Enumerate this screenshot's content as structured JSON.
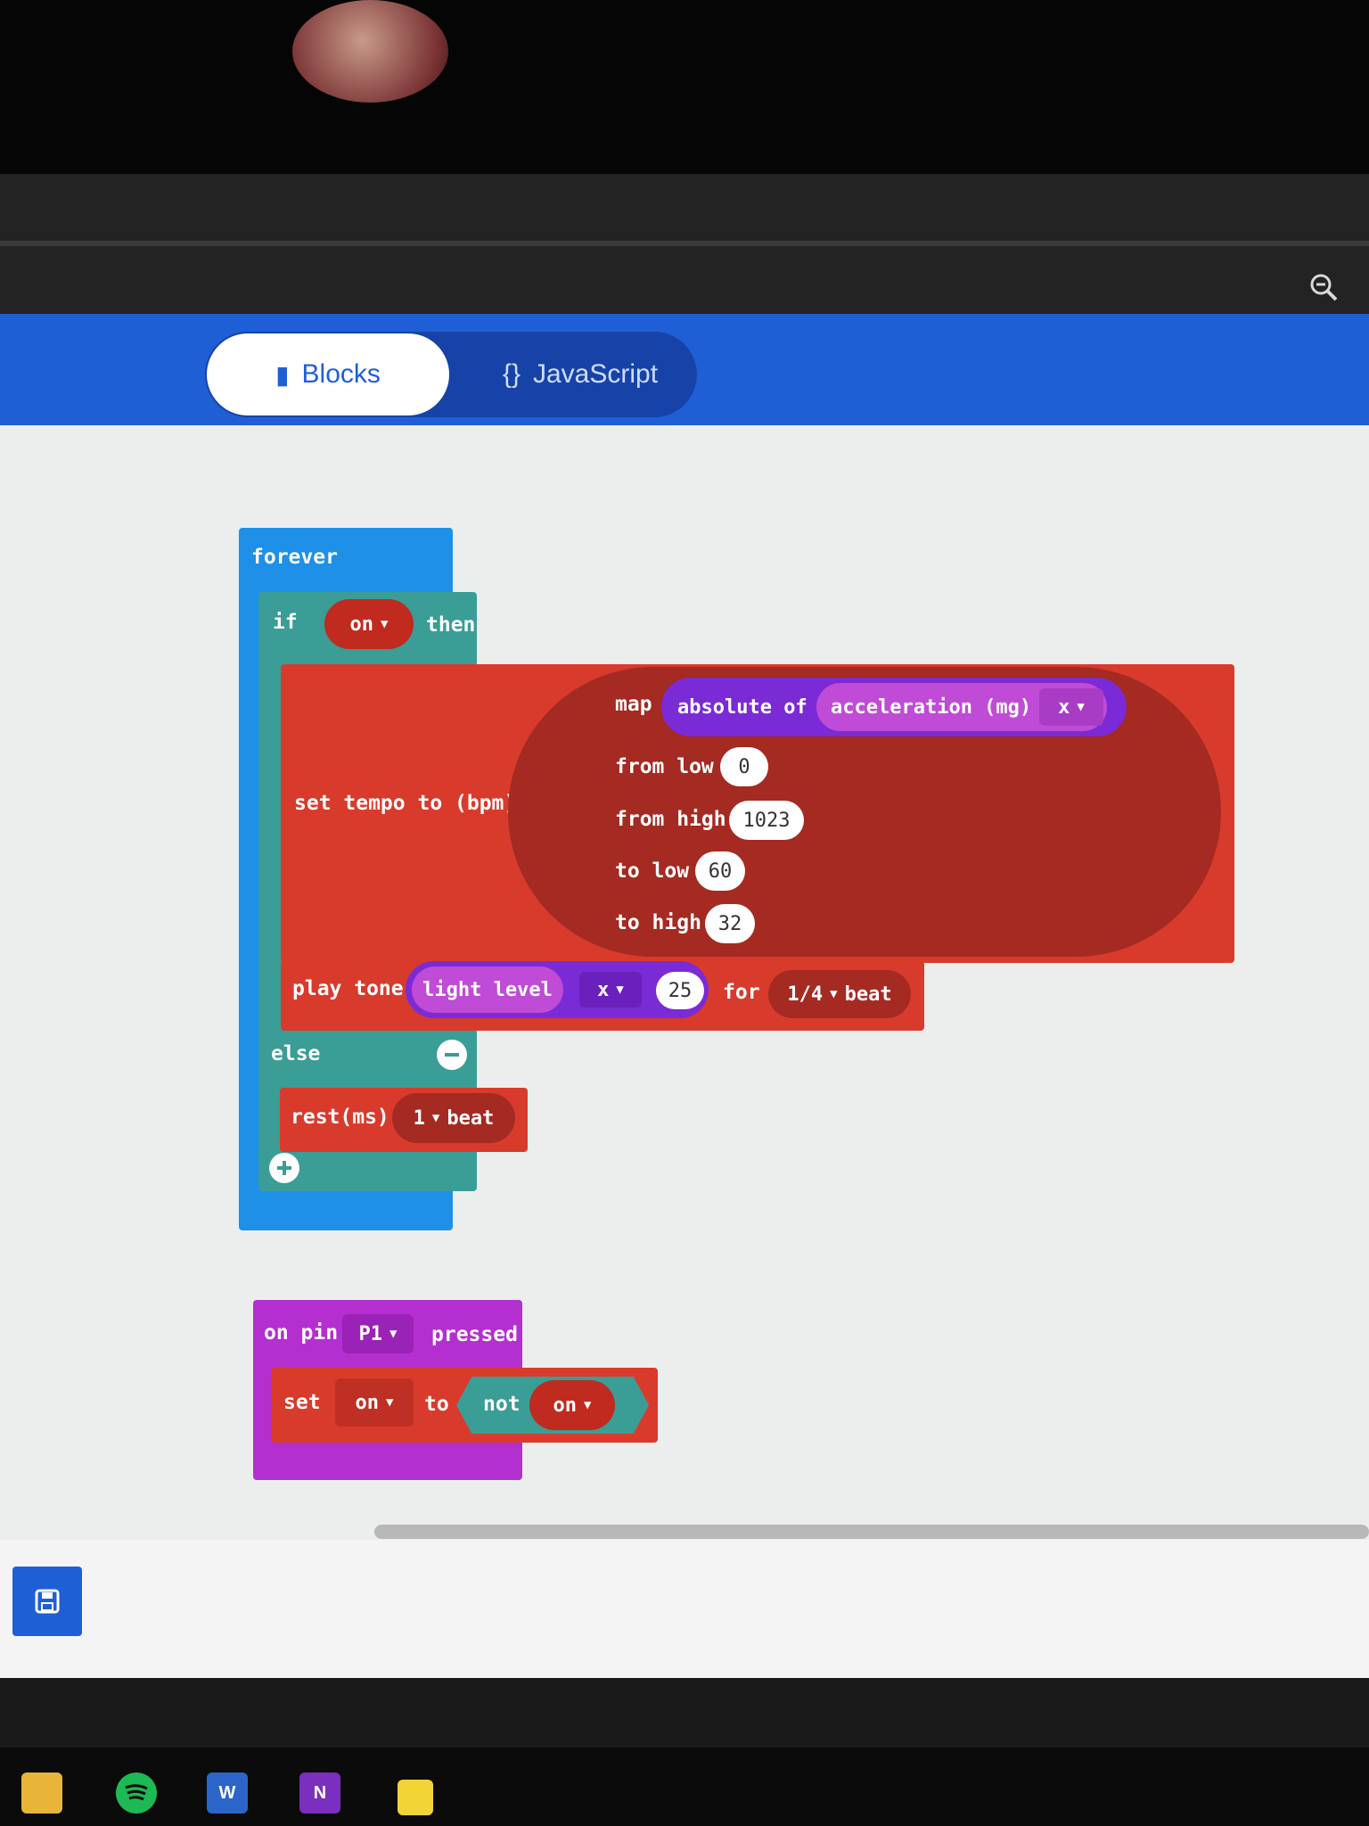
{
  "header": {
    "tabs": [
      {
        "label": "Blocks",
        "icon": "puzzle-icon"
      },
      {
        "label": "JavaScript",
        "icon": "braces-icon"
      }
    ],
    "active_tab": "Blocks",
    "zoom_icon": "zoom-icon"
  },
  "colors": {
    "header_blue": "#1f5fd6",
    "loops_blue": "#1e90e8",
    "logic_teal": "#3a9d96",
    "music_red": "#d83b2c",
    "sensor_purple": "#7a2bd6",
    "pins_magenta": "#b42fd0"
  },
  "forever_block": {
    "label": "forever",
    "if": {
      "if_label": "if",
      "condition": "on",
      "then_label": "then",
      "set_tempo": {
        "label": "set tempo to (bpm)",
        "map_label": "map",
        "absolute_label": "absolute of",
        "accel_label": "acceleration (mg)",
        "axis": "x",
        "from_low_label": "from low",
        "from_low": "0",
        "from_high_label": "from high",
        "from_high": "1023",
        "to_low_label": "to low",
        "to_low": "60",
        "to_high_label": "to high",
        "to_high": "32"
      },
      "play_tone": {
        "label": "play tone",
        "sensor": "light level",
        "axis": "x",
        "value": "25",
        "for_label": "for",
        "duration": "1/4",
        "beat_label": "beat"
      },
      "else_label": "else",
      "rest": {
        "label": "rest(ms)",
        "duration": "1",
        "beat_label": "beat"
      }
    }
  },
  "pin_block": {
    "on_pin_label": "on pin",
    "pin": "P1",
    "pressed_label": "pressed",
    "set_label": "set",
    "variable": "on",
    "to_label": "to",
    "not_label": "not",
    "not_variable": "on"
  },
  "taskbar": {
    "apps": [
      "folder-icon",
      "spotify-icon",
      "word-icon",
      "onenote-icon",
      "sticky-notes-icon"
    ],
    "word_letter": "W",
    "onenote_letter": "N"
  }
}
